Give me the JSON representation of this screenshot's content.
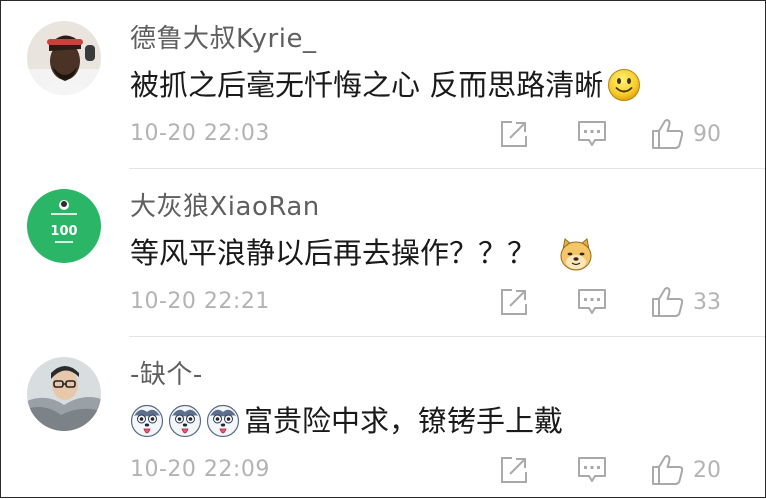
{
  "comments": [
    {
      "username": "德鲁大叔Kyrie_",
      "content": "被抓之后毫无忏悔之心 反而思路清晰",
      "trailing_emoji": "smile-emoji",
      "timestamp": "10-20 22:03",
      "likes": "90"
    },
    {
      "username": "大灰狼XiaoRan",
      "content": "等风平浪静以后再去操作？？？",
      "trailing_emoji": "doge-emoji",
      "timestamp": "10-20 22:21",
      "likes": "33",
      "avatar_text": "100"
    },
    {
      "username": "-缺个-",
      "leading_emoji": [
        "husky-tongue-emoji",
        "husky-tongue-emoji",
        "husky-tongue-emoji"
      ],
      "content": "富贵险中求，镣铐手上戴",
      "timestamp": "10-20 22:09",
      "likes": "20"
    }
  ],
  "icons": {
    "share": "share-icon",
    "reply": "reply-icon",
    "like": "thumbs-up-icon"
  },
  "colors": {
    "username": "#5f5f5f",
    "content": "#1a1a1a",
    "meta": "#b3b3b3",
    "divider": "#e4e4e4",
    "avatar2_bg": "#2ab567"
  }
}
